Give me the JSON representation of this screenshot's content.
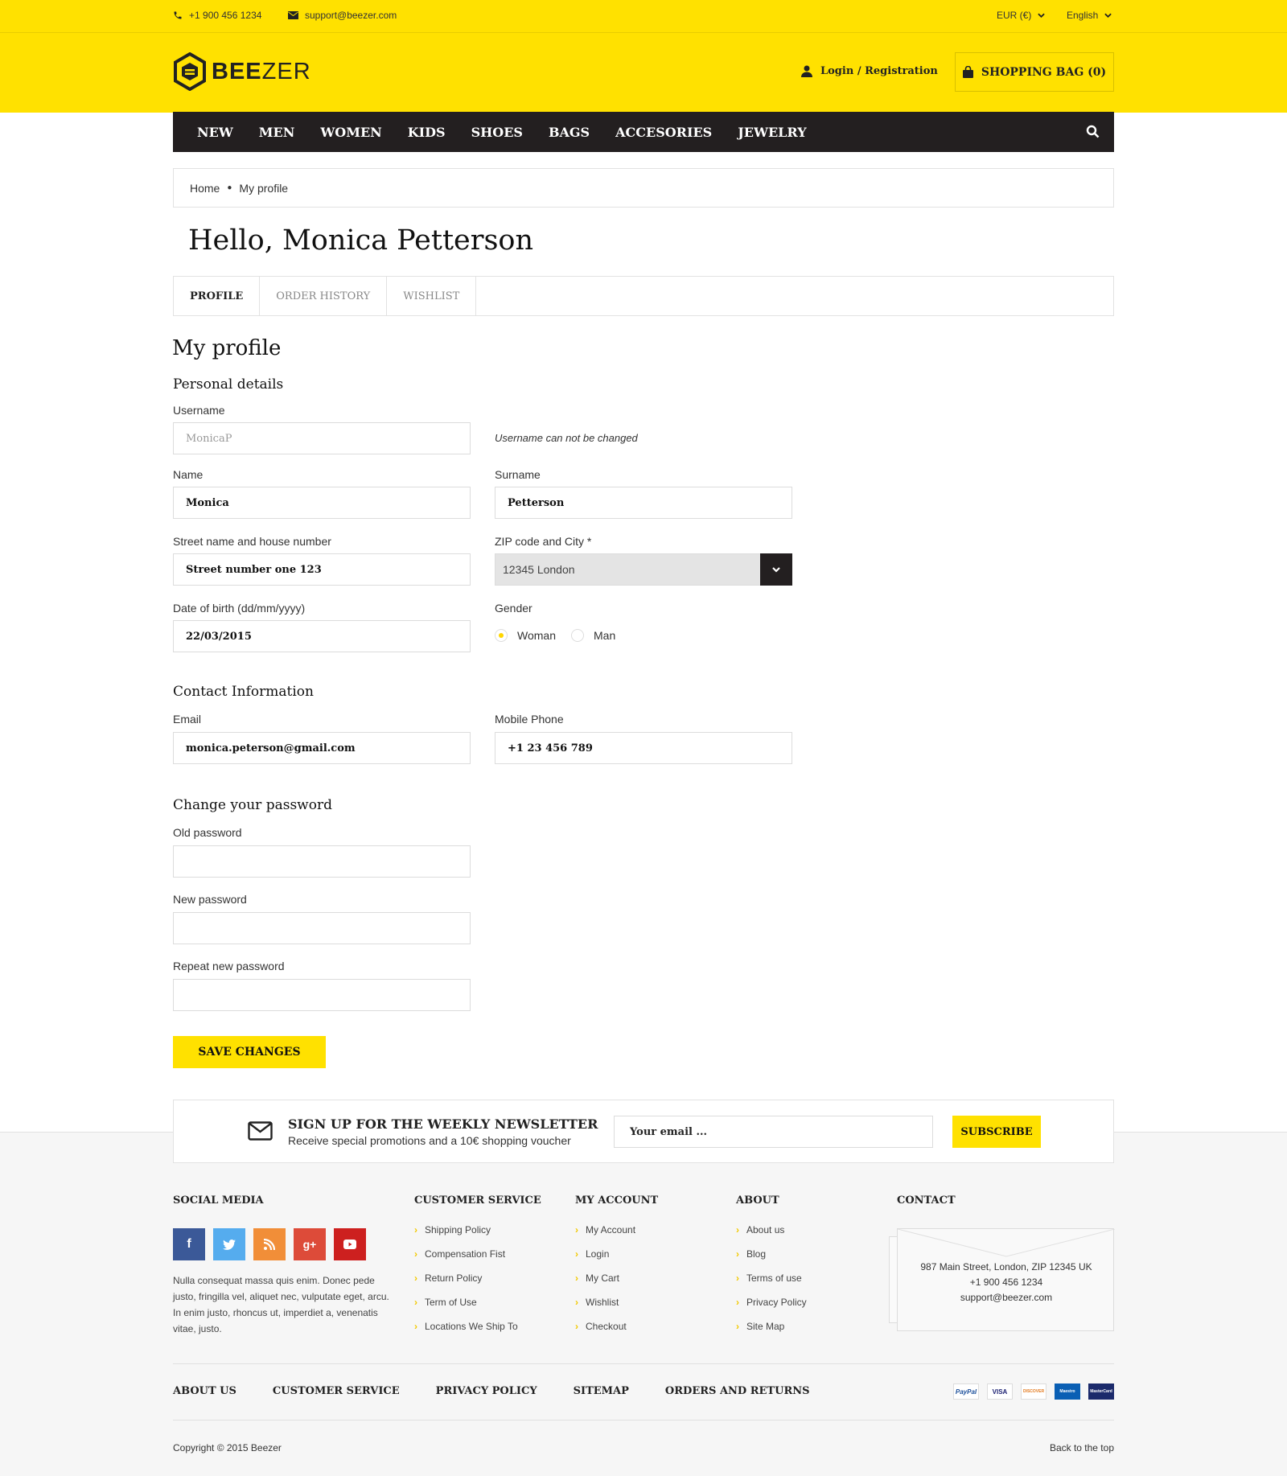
{
  "topbar": {
    "phone": "+1 900 456 1234",
    "email": "support@beezer.com",
    "currency": "EUR (€)",
    "language": "English"
  },
  "header": {
    "logo_bold": "BEE",
    "logo_light": "ZER",
    "login": "Login / Registration",
    "bag": "SHOPPING BAG (0)"
  },
  "nav": [
    "NEW",
    "MEN",
    "WOMEN",
    "KIDS",
    "SHOES",
    "BAGS",
    "ACCESORIES",
    "JEWELRY"
  ],
  "breadcrumb": {
    "home": "Home",
    "current": "My profile"
  },
  "greeting": "Hello, Monica Petterson",
  "tabs": [
    "PROFILE",
    "ORDER HISTORY",
    "WISHLIST"
  ],
  "profile": {
    "title": "My profile",
    "personal_title": "Personal details",
    "username_label": "Username",
    "username_value": "MonicaP",
    "username_note": "Username can not be changed",
    "name_label": "Name",
    "name_value": "Monica",
    "surname_label": "Surname",
    "surname_value": "Petterson",
    "street_label": "Street name and house number",
    "street_value": "Street number one 123",
    "zip_label": "ZIP code and City *",
    "zip_value": "12345 London",
    "dob_label": "Date of birth (dd/mm/yyyy)",
    "dob_value": "22/03/2015",
    "gender_label": "Gender",
    "gender_woman": "Woman",
    "gender_man": "Man",
    "gender_selected": "Woman",
    "contact_title": "Contact Information",
    "email_label": "Email",
    "email_value": "monica.peterson@gmail.com",
    "mobile_label": "Mobile Phone",
    "mobile_value": "+1 23 456 789",
    "password_title": "Change your password",
    "old_pw_label": "Old password",
    "new_pw_label": "New password",
    "repeat_pw_label": "Repeat new password",
    "save": "SAVE CHANGES"
  },
  "newsletter": {
    "title": "SIGN UP FOR THE WEEKLY NEWSLETTER",
    "text": "Receive special promotions and a 10€ shopping voucher",
    "placeholder": "Your email ...",
    "button": "SUBSCRIBE"
  },
  "footer": {
    "social_title": "SOCIAL MEDIA",
    "social_text": "Nulla consequat massa quis enim. Donec pede justo, fringilla vel, aliquet nec, vulputate eget, arcu. In enim justo, rhoncus ut, imperdiet a, venenatis vitae, justo.",
    "customer_service_title": "CUSTOMER SERVICE",
    "customer_service": [
      "Shipping Policy",
      "Compensation Fist",
      "Return Policy",
      "Term of Use",
      "Locations We Ship To"
    ],
    "my_account_title": "MY ACCOUNT",
    "my_account": [
      "My Account",
      "Login",
      "My Cart",
      "Wishlist",
      "Checkout"
    ],
    "about_title": "ABOUT",
    "about": [
      "About us",
      "Blog",
      "Terms of use",
      "Privacy Policy",
      "Site Map"
    ],
    "contact_title": "CONTACT",
    "contact_address": "987 Main Street, London, ZIP 12345 UK",
    "contact_phone": "+1 900 456 1234",
    "contact_email": "support@beezer.com",
    "bottom_links": [
      "ABOUT US",
      "CUSTOMER SERVICE",
      "PRIVACY POLICY",
      "SITEMAP",
      "ORDERS AND RETURNS"
    ],
    "payments": [
      "PayPal",
      "VISA",
      "DISCOVER",
      "Maestro",
      "MasterCard"
    ],
    "copyright": "Copyright © 2015 Beezer",
    "back_to_top": "Back to the top"
  },
  "colors": {
    "accent": "#ffe100",
    "dark": "#231f20"
  },
  "icons": [
    "phone-icon",
    "envelope-icon",
    "chevron-down-icon",
    "logo-icon",
    "user-icon",
    "bag-icon",
    "search-icon",
    "mail-icon",
    "facebook-icon",
    "twitter-icon",
    "rss-icon",
    "google-plus-icon",
    "youtube-icon",
    "chevron-right-icon"
  ]
}
